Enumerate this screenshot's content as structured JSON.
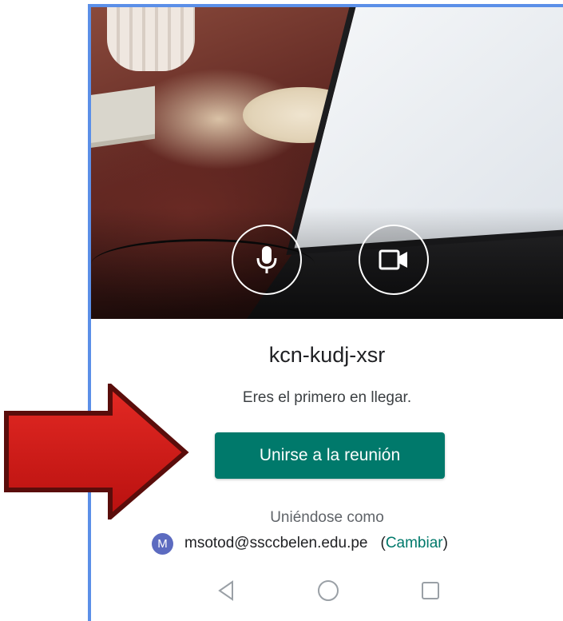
{
  "meeting": {
    "code": "kcn-kudj-xsr",
    "status": "Eres el primero en llegar.",
    "join_label": "Unirse a la reunión",
    "joining_as_label": "Uniéndose como",
    "account_initial": "M",
    "account_email": "msotod@ssccbelen.edu.pe",
    "change_open": "(",
    "change_label": "Cambiar",
    "change_close": ")"
  },
  "preview": {
    "mic_icon": "microphone-icon",
    "camera_icon": "video-camera-icon"
  },
  "navbar": {
    "back_icon": "triangle-back-icon",
    "home_icon": "circle-home-icon",
    "recents_icon": "square-recents-icon"
  },
  "colors": {
    "accent": "#00796b",
    "avatar": "#5c6bc0",
    "frame_border": "#5b8fe8",
    "arrow": "#d01c1c"
  }
}
